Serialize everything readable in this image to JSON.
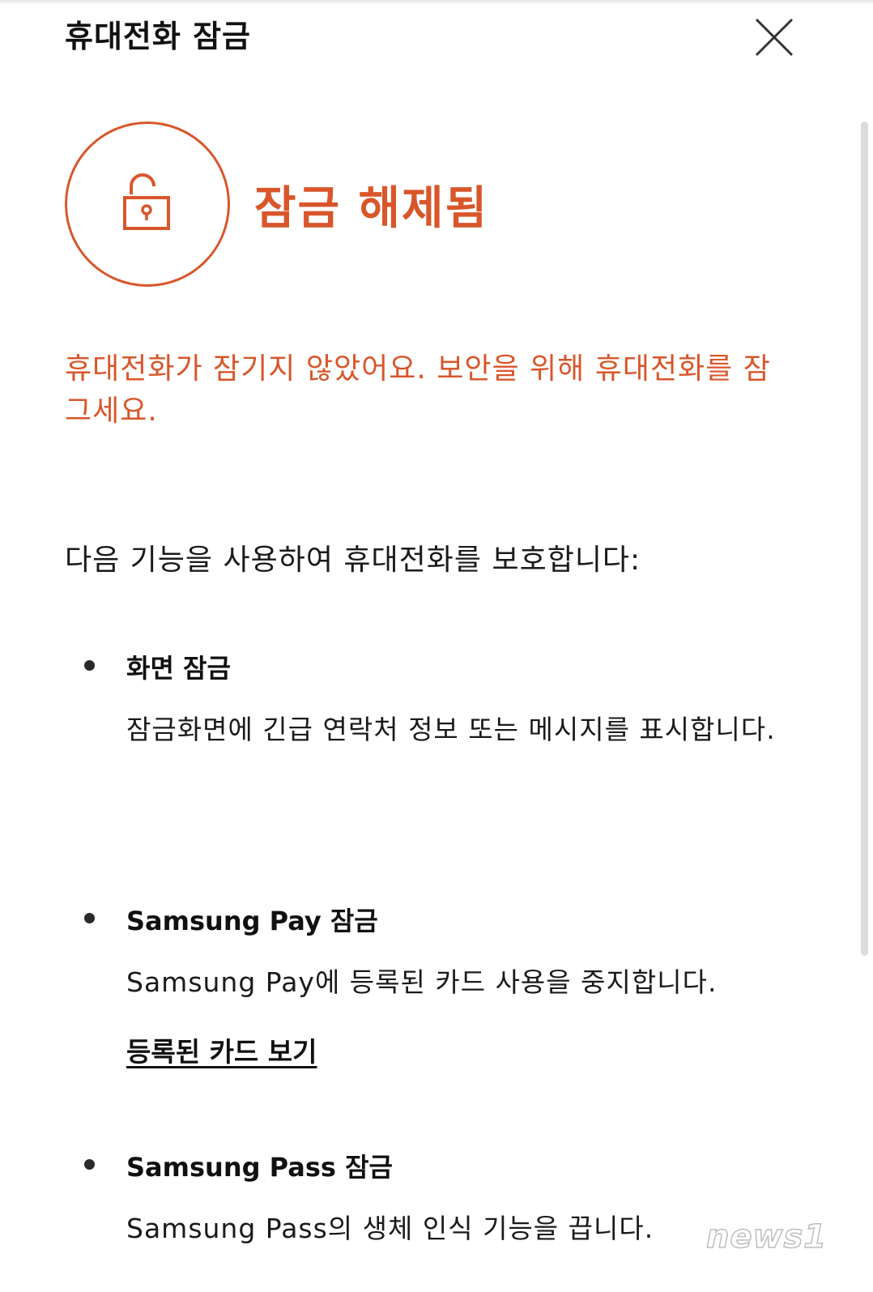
{
  "header": {
    "title": "휴대전화 잠금",
    "close_icon": "close-icon"
  },
  "status": {
    "icon": "unlock-icon",
    "title": "잠금 해제됨",
    "accent_color": "#d9562b"
  },
  "warning": {
    "text": "휴대전화가 잠기지 않았어요. 보안을 위해 휴대전화를 잠그세요."
  },
  "intro": {
    "text": "다음 기능을 사용하여 휴대전화를 보호합니다:"
  },
  "features": [
    {
      "title": "화면 잠금",
      "description": "잠금화면에 긴급 연락처 정보 또는 메시지를 표시합니다."
    },
    {
      "title": "Samsung Pay 잠금",
      "description": "Samsung Pay에 등록된 카드 사용을 중지합니다.",
      "link": "등록된 카드 보기"
    },
    {
      "title": "Samsung Pass 잠금",
      "description": "Samsung Pass의 생체 인식 기능을 끕니다."
    }
  ],
  "watermark": {
    "text": "news1"
  }
}
